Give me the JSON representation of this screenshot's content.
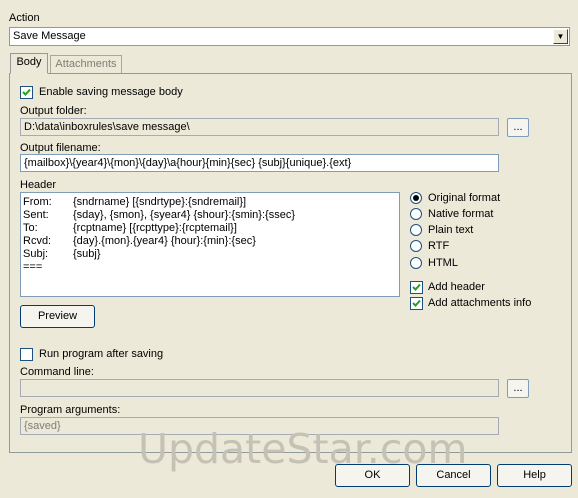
{
  "action": {
    "label": "Action",
    "selected": "Save Message"
  },
  "tabs": [
    {
      "label": "Body"
    },
    {
      "label": "Attachments"
    }
  ],
  "body": {
    "enable_saving": {
      "label": "Enable saving message body",
      "checked": true
    },
    "output_folder": {
      "label": "Output folder:",
      "value": "D:\\data\\inboxrules\\save message\\",
      "browse": "..."
    },
    "output_filename": {
      "label": "Output filename:",
      "value": "{mailbox}\\{year4}\\{mon}\\{day}\\a{hour}{min}{sec} {subj}{unique}.{ext}"
    },
    "header": {
      "label": "Header",
      "rows": [
        {
          "key": "From:",
          "value": "{sndrname} [{sndrtype}:{sndremail}]"
        },
        {
          "key": "Sent:",
          "value": "{sday}, {smon}, {syear4} {shour}:{smin}:{ssec}"
        },
        {
          "key": "To:",
          "value": "{rcptname} [{rcpttype}:{rcptemail}]"
        },
        {
          "key": "Rcvd:",
          "value": "{day}.{mon}.{year4} {hour}:{min}:{sec}"
        },
        {
          "key": "Subj:",
          "value": "{subj}"
        },
        {
          "key": "===",
          "value": ""
        }
      ]
    },
    "formats": [
      {
        "label": "Original format",
        "selected": true
      },
      {
        "label": "Native format",
        "selected": false
      },
      {
        "label": "Plain text",
        "selected": false
      },
      {
        "label": "RTF",
        "selected": false
      },
      {
        "label": "HTML",
        "selected": false
      }
    ],
    "add_header": {
      "label": "Add header",
      "checked": true
    },
    "add_attachments_info": {
      "label": "Add attachments info",
      "checked": true
    },
    "preview_button": "Preview",
    "run_program": {
      "label": "Run program after saving",
      "checked": false
    },
    "command_line": {
      "label": "Command line:",
      "value": "",
      "browse": "..."
    },
    "program_arguments": {
      "label": "Program arguments:",
      "value": "{saved}"
    }
  },
  "watermark": "UpdateStar.com",
  "buttons": {
    "ok": "OK",
    "cancel": "Cancel",
    "help": "Help"
  }
}
